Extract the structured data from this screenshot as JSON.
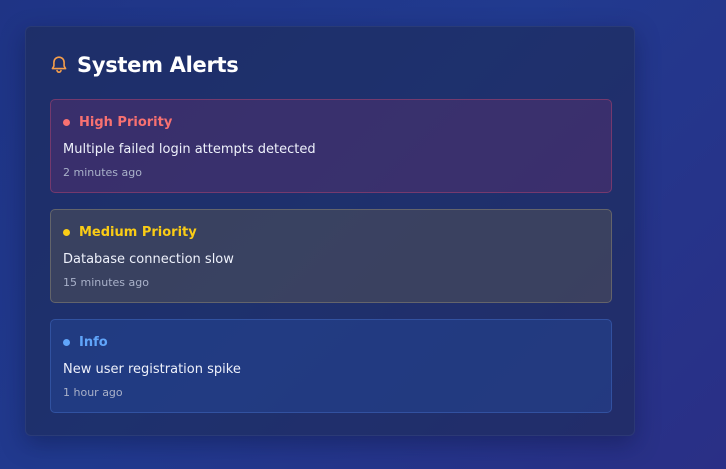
{
  "panel": {
    "title": "System Alerts",
    "icon": "bell-icon",
    "icon_color": "#f59e4b"
  },
  "alerts": [
    {
      "level": "High Priority",
      "message": "Multiple failed login attempts detected",
      "time": "2 minutes ago",
      "color": "#f87171"
    },
    {
      "level": "Medium Priority",
      "message": "Database connection slow",
      "time": "15 minutes ago",
      "color": "#facc15"
    },
    {
      "level": "Info",
      "message": "New user registration spike",
      "time": "1 hour ago",
      "color": "#60a5fa"
    }
  ]
}
